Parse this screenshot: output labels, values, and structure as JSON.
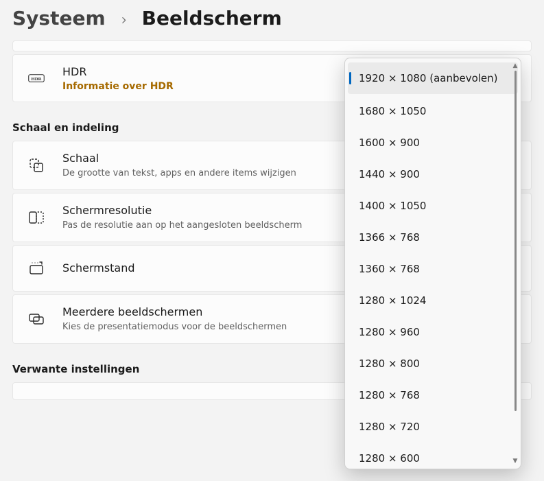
{
  "breadcrumb": {
    "parent": "Systeem",
    "current": "Beeldscherm"
  },
  "hdr": {
    "title": "HDR",
    "link": "Informatie over HDR"
  },
  "section_scale": "Schaal en indeling",
  "rows": {
    "scale": {
      "title": "Schaal",
      "sub": "De grootte van tekst, apps en andere items wijzigen"
    },
    "resolution": {
      "title": "Schermresolutie",
      "sub": "Pas de resolutie aan op het aangesloten beeldscherm"
    },
    "orientation": {
      "title": "Schermstand"
    },
    "multi": {
      "title": "Meerdere beeldschermen",
      "sub": "Kies de presentatiemodus voor de beeldschermen"
    }
  },
  "section_related": "Verwante instellingen",
  "resolution_options": [
    "1920 × 1080 (aanbevolen)",
    "1680 × 1050",
    "1600 × 900",
    "1440 × 900",
    "1400 × 1050",
    "1366 × 768",
    "1360 × 768",
    "1280 × 1024",
    "1280 × 960",
    "1280 × 800",
    "1280 × 768",
    "1280 × 720",
    "1280 × 600"
  ],
  "resolution_selected_index": 0
}
